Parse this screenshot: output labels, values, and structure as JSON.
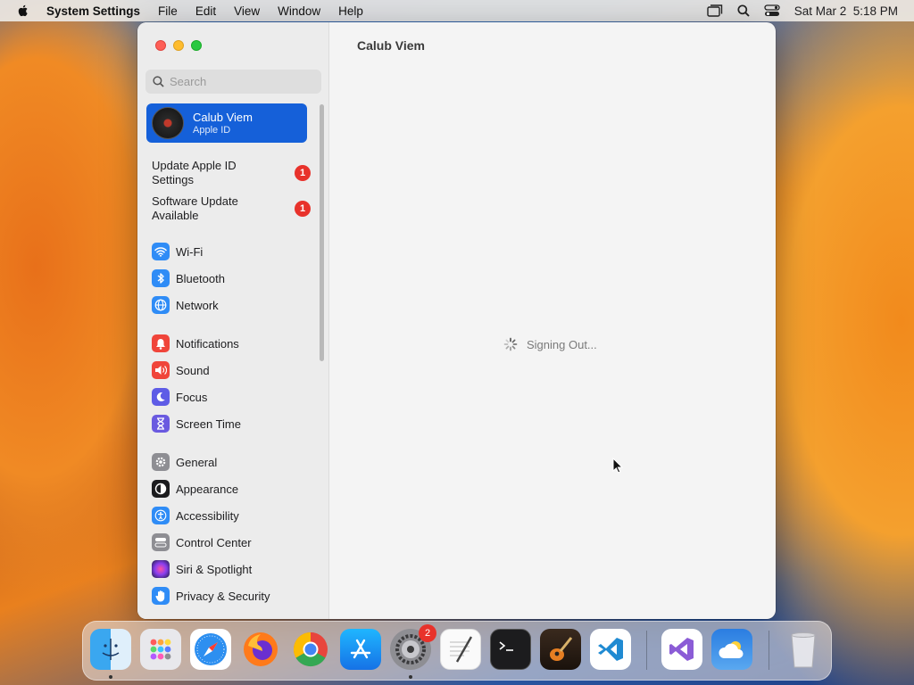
{
  "menubar": {
    "app_name": "System Settings",
    "menus": [
      "File",
      "Edit",
      "View",
      "Window",
      "Help"
    ],
    "clock": "Sat Mar 2  5:18 PM"
  },
  "window": {
    "title": "Calub Viem",
    "search": {
      "placeholder": "Search",
      "value": ""
    },
    "account": {
      "name": "Calub Viem",
      "subtitle": "Apple ID"
    },
    "notices": [
      {
        "label": "Update Apple ID Settings",
        "badge": "1"
      },
      {
        "label": "Software Update Available",
        "badge": "1"
      }
    ],
    "groups": [
      [
        {
          "label": "Wi-Fi",
          "icon": "wifi-icon",
          "color": "#2f8cf6"
        },
        {
          "label": "Bluetooth",
          "icon": "bluetooth-icon",
          "color": "#2f8cf6"
        },
        {
          "label": "Network",
          "icon": "globe-icon",
          "color": "#2f8cf6"
        }
      ],
      [
        {
          "label": "Notifications",
          "icon": "bell-icon",
          "color": "#f0453a"
        },
        {
          "label": "Sound",
          "icon": "speaker-icon",
          "color": "#f0453a"
        },
        {
          "label": "Focus",
          "icon": "moon-icon",
          "color": "#5e5ce6"
        },
        {
          "label": "Screen Time",
          "icon": "hourglass-icon",
          "color": "#6a5ae0"
        }
      ],
      [
        {
          "label": "General",
          "icon": "gear-icon",
          "color": "#8e8e93"
        },
        {
          "label": "Appearance",
          "icon": "appearance-icon",
          "color": "#1c1c1e"
        },
        {
          "label": "Accessibility",
          "icon": "accessibility-icon",
          "color": "#2f8cf6"
        },
        {
          "label": "Control Center",
          "icon": "control-center-icon",
          "color": "#8e8e93"
        },
        {
          "label": "Siri & Spotlight",
          "icon": "siri-icon",
          "color": "#c13fd8"
        },
        {
          "label": "Privacy & Security",
          "icon": "hand-icon",
          "color": "#2f8cf6"
        }
      ]
    ],
    "status_text": "Signing Out..."
  },
  "dock": {
    "apps": [
      {
        "name": "finder-icon",
        "running": true
      },
      {
        "name": "launchpad-icon",
        "running": false
      },
      {
        "name": "safari-icon",
        "running": false
      },
      {
        "name": "firefox-icon",
        "running": false
      },
      {
        "name": "chrome-icon",
        "running": false
      },
      {
        "name": "app-store-icon",
        "running": false
      },
      {
        "name": "system-settings-icon",
        "running": true,
        "badge": "2"
      },
      {
        "name": "textedit-icon",
        "running": false
      },
      {
        "name": "terminal-icon",
        "running": false
      },
      {
        "name": "garageband-icon",
        "running": false
      },
      {
        "name": "vscode-icon",
        "running": false
      },
      {
        "name": "visual-studio-icon",
        "running": false
      },
      {
        "name": "weather-icon",
        "running": false
      },
      {
        "name": "trash-icon",
        "running": false
      }
    ]
  }
}
